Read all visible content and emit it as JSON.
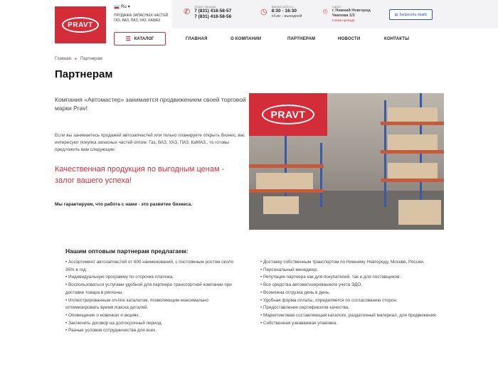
{
  "header": {
    "logo_text": "PRAVT",
    "lang": "Ru",
    "tagline": "ПРОДАЖА ЗАПАСНЫХ ЧАСТЕЙ ГАЗ, ВАЗ, ПАЗ, УАЗ, КАМАЗ",
    "sales_label": "Отдел продаж:",
    "phones": [
      "7 (831) 418-58-57",
      "7 (831) 418-58-56"
    ],
    "hours_label": "Время работы:",
    "hours": "8:30 - 16:30",
    "hours_note": "сб,вс - выходной",
    "address_label": "Адрес:",
    "address_lines": [
      "г. Нижний Новгород",
      "Чкалова 1/3"
    ],
    "map_link": "Схема проезда",
    "price_button": "Запросить прайс"
  },
  "nav": {
    "catalog_label": "КАТАЛОГ",
    "items": [
      "ГЛАВНАЯ",
      "О КОМПАНИИ",
      "ПАРТНЕРАМ",
      "НОВОСТИ",
      "КОНТАКТЫ"
    ]
  },
  "breadcrumb": [
    "Главная",
    "Партнерам"
  ],
  "page_title": "Партнерам",
  "content": {
    "intro": "Компания «Автомастер» занимается продвижением своей торговой марки Prav!",
    "para2": "Если вы занимаетесь продажей автозапчастей или только планируете открыть бизнес, вас интересуют покупка запасных частей оптом: Газ, ВАЗ, УАЗ, ПАЗ, КаМАЗ., то готовы предложить вам следующие:",
    "highlight": "Качественная продукция по выгодным ценам - залог вашего успеха!",
    "guarantee": "Мы гарантируем, что работа с нами - это развитие бизнеса.",
    "photo_logo": "PRAVT"
  },
  "offer": {
    "title": "Нашим оптовым партнерам предлагаем:",
    "left": [
      "Ассортимент автозапчастей от 600 наименований, с постоянным ростом около 35% в год.",
      "Индивидуальную программу по отсрочке платежа.",
      "Воспользоваться услугами удобной для партнера транспортной компании при доставке товара в регионы.",
      "Иллюстрированным on-line каталогом, позволяющим максимально оптимизировать время поиска деталей.",
      "Оповещение о новинках и акциях.",
      "Заключить договор на долгосрочный период.",
      "Разные условия сотрудничества для всех."
    ],
    "right": [
      "Доставку собственным транспортом по Нижнему Новгороду, Москве, России.",
      "Персональный менеджер.",
      "Репутация партнера как для покупателей, так и для поставщиков.",
      "Все средства автоматизированного учета ЭДО.",
      "Возможна отгрузка день в день.",
      "Удобная форма оплаты, определяется по согласованию сторон.",
      "Предоставление сертификатов качества.",
      "Маркетинговая составляющая каталоги, раздаточный материал, для продвижения.",
      "Собственная узнаваемая упаковка."
    ]
  }
}
